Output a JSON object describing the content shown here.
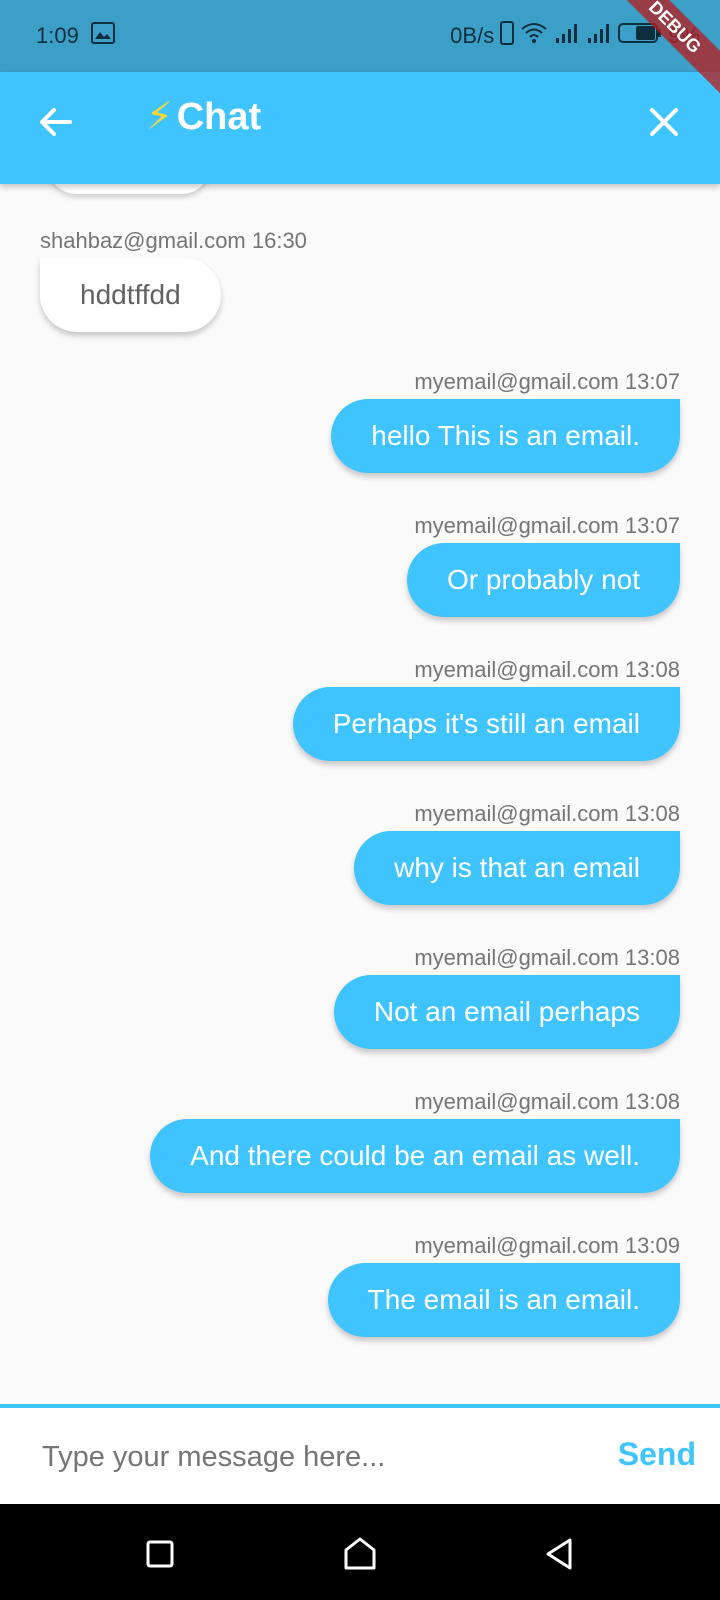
{
  "status_bar": {
    "time": "1:09",
    "speed": "0B/s",
    "battery": "9%"
  },
  "app_bar": {
    "title_emoji": "⚡",
    "title": "Chat"
  },
  "messages": [
    {
      "meta": "shahbaz@gmail.com 16:30",
      "text": "hddtffdd",
      "type": "received"
    },
    {
      "meta": "myemail@gmail.com 13:07",
      "text": "hello This is an email.",
      "type": "sent"
    },
    {
      "meta": "myemail@gmail.com 13:07",
      "text": "Or probably not",
      "type": "sent"
    },
    {
      "meta": "myemail@gmail.com 13:08",
      "text": "Perhaps it's still an email",
      "type": "sent"
    },
    {
      "meta": "myemail@gmail.com 13:08",
      "text": "why is that an email",
      "type": "sent"
    },
    {
      "meta": "myemail@gmail.com 13:08",
      "text": "Not an email perhaps",
      "type": "sent"
    },
    {
      "meta": "myemail@gmail.com 13:08",
      "text": "And there could be an email as well.",
      "type": "sent"
    },
    {
      "meta": "myemail@gmail.com 13:09",
      "text": "The email is an email.",
      "type": "sent"
    }
  ],
  "composer": {
    "placeholder": "Type your message here...",
    "value": "",
    "send_label": "Send"
  },
  "debug_banner": "DEBUG",
  "colors": {
    "accent": "#40c4ff",
    "status_bar": "#3c9fc8"
  }
}
